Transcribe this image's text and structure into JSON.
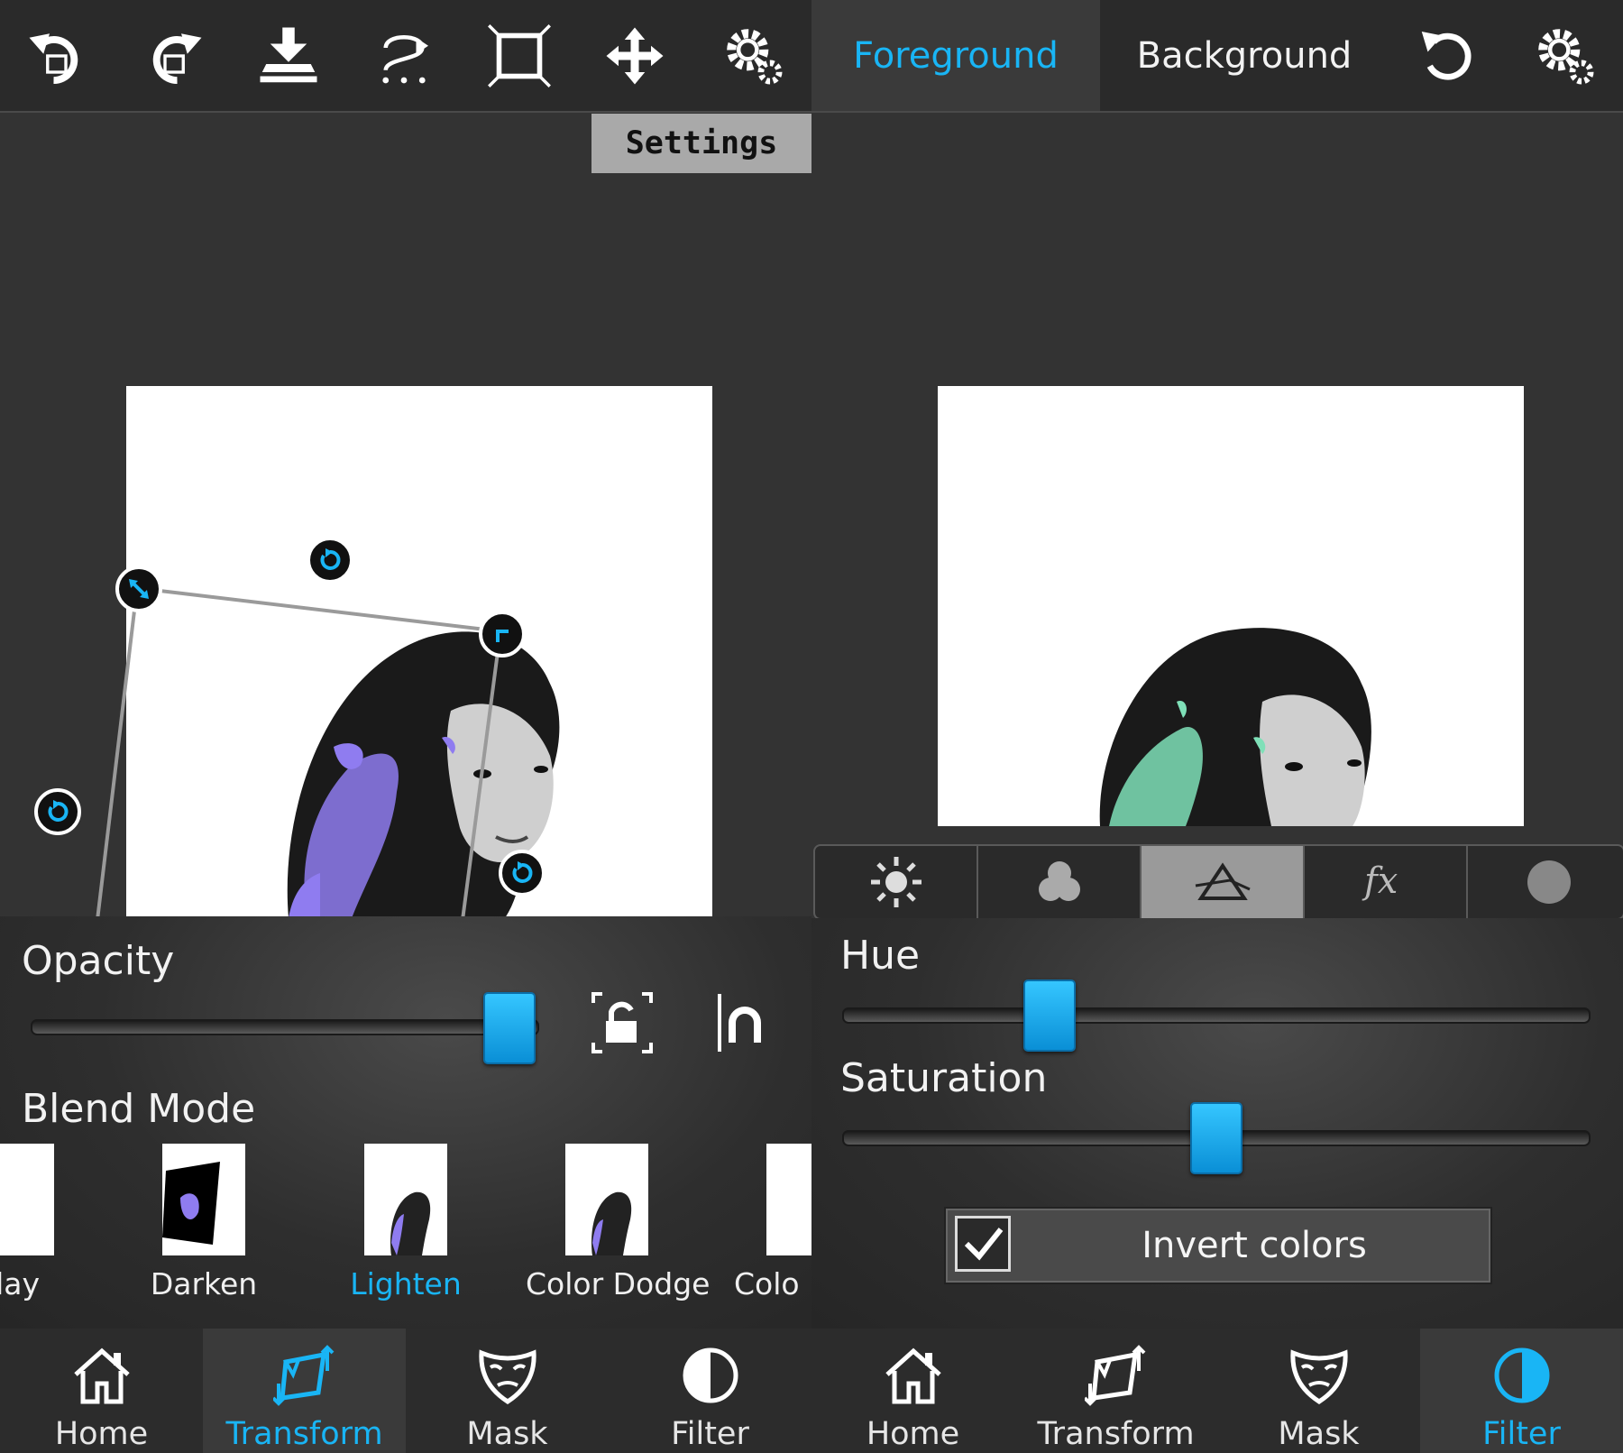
{
  "left": {
    "toolbar": {
      "undo_icon": "undo-icon",
      "redo_icon": "redo-icon",
      "merge_icon": "merge-down-icon",
      "flip_icon": "flip-icon",
      "fit_icon": "fit-frame-icon",
      "move_icon": "move-icon",
      "settings_icon": "gear-icon"
    },
    "tooltip": "Settings",
    "opacity_label": "Opacity",
    "opacity_value": 0.85,
    "blend_mode_label": "Blend Mode",
    "blend_modes": [
      "lay",
      "Darken",
      "Lighten",
      "Color Dodge",
      "Colo"
    ],
    "blend_selected": "Lighten",
    "nav": [
      {
        "label": "Home",
        "icon": "home-icon"
      },
      {
        "label": "Transform",
        "icon": "transform-icon"
      },
      {
        "label": "Mask",
        "icon": "mask-icon"
      },
      {
        "label": "Filter",
        "icon": "filter-icon"
      }
    ],
    "nav_active": "Transform"
  },
  "right": {
    "tabs": {
      "foreground": "Foreground",
      "background": "Background"
    },
    "active_tab": "Foreground",
    "filter_tabs": [
      "brightness-icon",
      "color-balance-icon",
      "prism-hue-icon",
      "fx-icon",
      "blur-icon"
    ],
    "fx_text": "fx",
    "active_filter_tab": "prism-hue-icon",
    "hue_label": "Hue",
    "hue_value": 0.26,
    "saturation_label": "Saturation",
    "saturation_value": 0.5,
    "invert_label": "Invert colors",
    "invert_checked": true,
    "nav": [
      {
        "label": "Home",
        "icon": "home-icon"
      },
      {
        "label": "Transform",
        "icon": "transform-icon"
      },
      {
        "label": "Mask",
        "icon": "mask-icon"
      },
      {
        "label": "Filter",
        "icon": "filter-icon"
      }
    ],
    "nav_active": "Filter"
  },
  "colors": {
    "accent": "#19b5f5",
    "foreground_tint_left": "#8f7cf0",
    "foreground_tint_right": "#7fe0b8"
  }
}
